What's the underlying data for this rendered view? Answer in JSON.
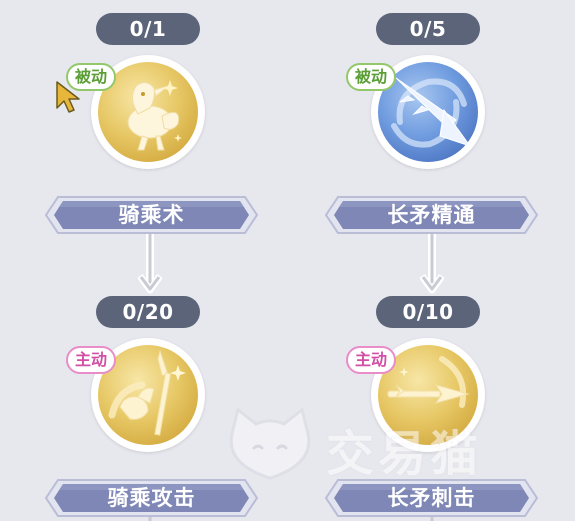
{
  "skills": [
    {
      "level": "0/1",
      "type_label": "被动",
      "type": "passive",
      "name": "骑乘术",
      "icon": "chocobo-bird-icon",
      "disc_color": "#e7c866"
    },
    {
      "level": "0/5",
      "type_label": "被动",
      "type": "passive",
      "name": "长矛精通",
      "icon": "spear-mastery-icon",
      "disc_color": "#6f9bdf"
    },
    {
      "level": "0/20",
      "type_label": "主动",
      "type": "active",
      "name": "骑乘攻击",
      "icon": "mounted-attack-icon",
      "disc_color": "#e7c866"
    },
    {
      "level": "0/10",
      "type_label": "主动",
      "type": "active",
      "name": "长矛刺击",
      "icon": "spear-thrust-icon",
      "disc_color": "#e7c866"
    }
  ],
  "watermark": {
    "text": "交易猫",
    "icon": "cat-logo-icon"
  },
  "colors": {
    "background": "#e7e7ee",
    "pill": "#5b6478",
    "banner": "#7e87b6",
    "passive_tag": "#5a9e35",
    "active_tag": "#d24fa4"
  },
  "cursor": {
    "icon": "mouse-pointer-icon"
  }
}
